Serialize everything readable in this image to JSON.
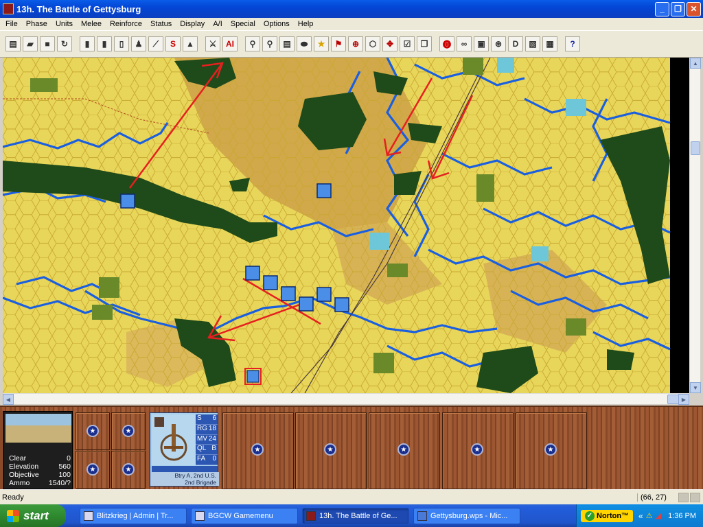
{
  "window": {
    "title": "13h. The Battle of Gettysburg"
  },
  "menu": [
    "File",
    "Phase",
    "Units",
    "Melee",
    "Reinforce",
    "Status",
    "Display",
    "A/I",
    "Special",
    "Options",
    "Help"
  ],
  "toolbar": {
    "group1": [
      "new-icon",
      "open-icon",
      "save-icon",
      "recycle-icon"
    ],
    "group2": [
      "can-icon",
      "can2-icon",
      "pill-icon",
      "soldier-icon",
      "rifle-icon",
      "S",
      "pyramid-icon",
      "sword-icon",
      "AI"
    ],
    "group3": [
      "pin-icon",
      "pin2-icon",
      "scroll-icon",
      "hat-icon",
      "star-icon",
      "flag-icon",
      "target-icon",
      "hex-icon",
      "move-icon",
      "check-icon",
      "copy-icon"
    ],
    "group4": [
      "stop-icon",
      "binoculars-icon",
      "lock-icon",
      "wheel-icon",
      "D",
      "doc-icon",
      "window-icon"
    ],
    "help": "?"
  },
  "terrain": {
    "stats": [
      {
        "label": "Clear",
        "value": "0"
      },
      {
        "label": "Elevation",
        "value": "560"
      },
      {
        "label": "Objective",
        "value": "100"
      },
      {
        "label": "Ammo",
        "value": "1540/?"
      }
    ]
  },
  "unit": {
    "stats": [
      {
        "label": "S",
        "value": "6"
      },
      {
        "label": "RG",
        "value": "18"
      },
      {
        "label": "MV",
        "value": "24"
      },
      {
        "label": "QL",
        "value": "B"
      },
      {
        "label": "FA",
        "value": "0"
      }
    ],
    "name": "Btry A, 2nd U.S.",
    "brigade": "2nd Brigade"
  },
  "status": {
    "ready": "Ready",
    "coords": "(66, 27)"
  },
  "taskbar": {
    "start": "start",
    "tasks": [
      "Blitzkrieg | Admin | Tr...",
      "BGCW Gamemenu",
      "13h. The Battle of Ge...",
      "Gettysburg.wps - Mic..."
    ],
    "norton": "Norton™",
    "clock": "1:36 PM"
  },
  "colors": {
    "accent": "#0a5ce8",
    "union": "#2b56b2",
    "terrain": "#e8d65a",
    "woods": "#1f4a1a",
    "river": "#1a5fe0",
    "arrow": "#e62020"
  }
}
